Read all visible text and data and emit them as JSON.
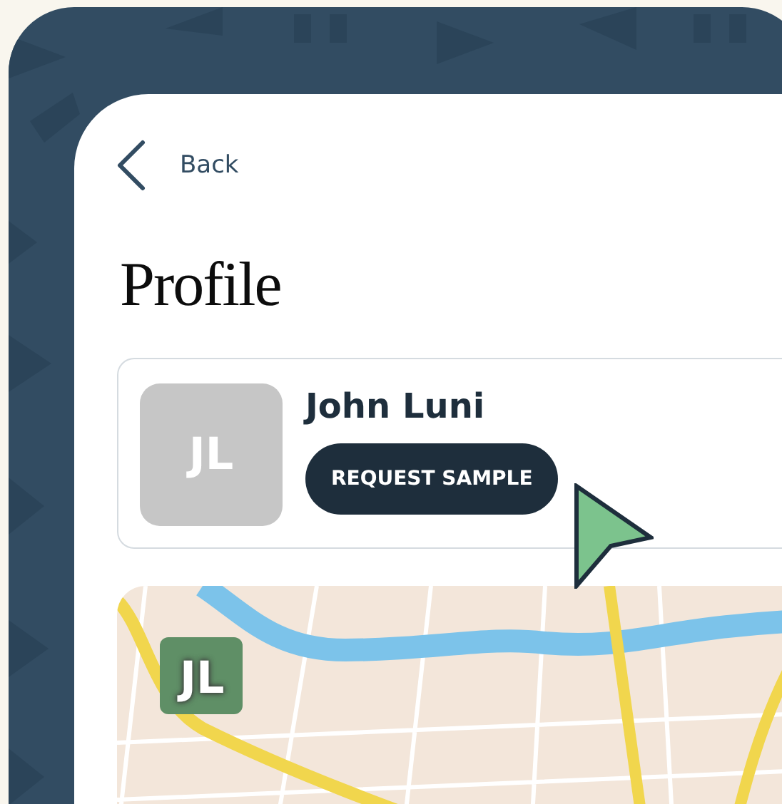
{
  "back": {
    "label": "Back"
  },
  "title": "Profile",
  "profile": {
    "initials": "JL",
    "name": "John Luni",
    "action": "REQUEST SAMPLE"
  },
  "map": {
    "kind": "picture",
    "label": "JL"
  }
}
